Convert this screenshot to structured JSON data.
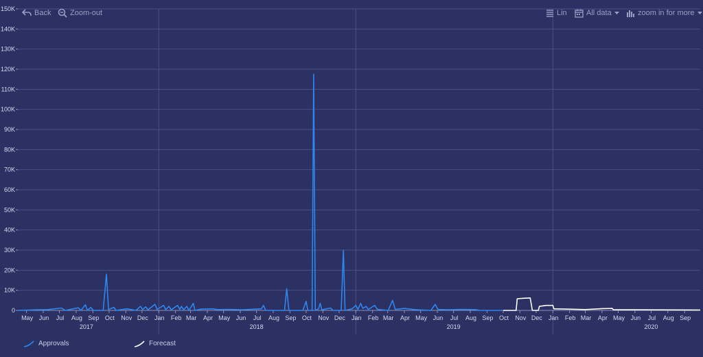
{
  "toolbar": {
    "back_label": "Back",
    "zoom_out_label": "Zoom-out",
    "scale_label": "Lin",
    "range_label": "All data",
    "zoom_in_label": "zoom in for more"
  },
  "legend": {
    "approvals_label": "Approvals",
    "forecast_label": "Forecast"
  },
  "colors": {
    "background": "#2b3163",
    "grid": "#4a5188",
    "approvals": "#2f86ee",
    "forecast": "#ffffff"
  },
  "chart_data": {
    "type": "line",
    "y_ticks": [
      "0",
      "10K",
      "20K",
      "30K",
      "40K",
      "50K",
      "60K",
      "70K",
      "80K",
      "90K",
      "100K",
      "110K",
      "120K",
      "130K",
      "140K",
      "150K"
    ],
    "ylim": [
      0,
      150000
    ],
    "x_range": [
      "2017-04-15",
      "2020-09-30"
    ],
    "month_ticks": [
      {
        "label": "May",
        "date": "2017-05-01"
      },
      {
        "label": "Jun",
        "date": "2017-06-01"
      },
      {
        "label": "Jul",
        "date": "2017-07-01"
      },
      {
        "label": "Aug",
        "date": "2017-08-01"
      },
      {
        "label": "Sep",
        "date": "2017-09-01"
      },
      {
        "label": "Oct",
        "date": "2017-10-01"
      },
      {
        "label": "Nov",
        "date": "2017-11-01"
      },
      {
        "label": "Dec",
        "date": "2017-12-01"
      },
      {
        "label": "Jan",
        "date": "2018-01-01"
      },
      {
        "label": "Feb",
        "date": "2018-02-01"
      },
      {
        "label": "Mar",
        "date": "2018-03-01"
      },
      {
        "label": "Apr",
        "date": "2018-04-01"
      },
      {
        "label": "May",
        "date": "2018-05-01"
      },
      {
        "label": "Jun",
        "date": "2018-06-01"
      },
      {
        "label": "Jul",
        "date": "2018-07-01"
      },
      {
        "label": "Aug",
        "date": "2018-08-01"
      },
      {
        "label": "Sep",
        "date": "2018-09-01"
      },
      {
        "label": "Oct",
        "date": "2018-10-01"
      },
      {
        "label": "Nov",
        "date": "2018-11-01"
      },
      {
        "label": "Dec",
        "date": "2018-12-01"
      },
      {
        "label": "Jan",
        "date": "2019-01-01"
      },
      {
        "label": "Feb",
        "date": "2019-02-01"
      },
      {
        "label": "Mar",
        "date": "2019-03-01"
      },
      {
        "label": "Apr",
        "date": "2019-04-01"
      },
      {
        "label": "May",
        "date": "2019-05-01"
      },
      {
        "label": "Jun",
        "date": "2019-06-01"
      },
      {
        "label": "Jul",
        "date": "2019-07-01"
      },
      {
        "label": "Aug",
        "date": "2019-08-01"
      },
      {
        "label": "Sep",
        "date": "2019-09-01"
      },
      {
        "label": "Oct",
        "date": "2019-10-01"
      },
      {
        "label": "Nov",
        "date": "2019-11-01"
      },
      {
        "label": "Dec",
        "date": "2019-12-01"
      },
      {
        "label": "Jan",
        "date": "2020-01-01"
      },
      {
        "label": "Feb",
        "date": "2020-02-01"
      },
      {
        "label": "Mar",
        "date": "2020-03-01"
      },
      {
        "label": "Apr",
        "date": "2020-04-01"
      },
      {
        "label": "May",
        "date": "2020-05-01"
      },
      {
        "label": "Jun",
        "date": "2020-06-01"
      },
      {
        "label": "Jul",
        "date": "2020-07-01"
      },
      {
        "label": "Aug",
        "date": "2020-08-01"
      },
      {
        "label": "Sep",
        "date": "2020-09-01"
      }
    ],
    "year_labels": [
      {
        "label": "2017",
        "date": "2017-08-20"
      },
      {
        "label": "2018",
        "date": "2018-07-01"
      },
      {
        "label": "2019",
        "date": "2019-07-01"
      },
      {
        "label": "2020",
        "date": "2020-07-01"
      }
    ],
    "year_boundaries": [
      "2018-01-01",
      "2019-01-01",
      "2020-01-01"
    ],
    "legend_position": "bottom-left",
    "grid": true,
    "series": [
      {
        "name": "Approvals",
        "points": [
          [
            "2017-04-15",
            0
          ],
          [
            "2017-05-20",
            300
          ],
          [
            "2017-06-10",
            400
          ],
          [
            "2017-07-05",
            1200
          ],
          [
            "2017-07-12",
            0
          ],
          [
            "2017-08-05",
            1300
          ],
          [
            "2017-08-10",
            0
          ],
          [
            "2017-08-18",
            2800
          ],
          [
            "2017-08-22",
            0
          ],
          [
            "2017-08-28",
            1500
          ],
          [
            "2017-09-02",
            0
          ],
          [
            "2017-09-20",
            0
          ],
          [
            "2017-09-26",
            18000
          ],
          [
            "2017-09-30",
            500
          ],
          [
            "2017-10-10",
            1500
          ],
          [
            "2017-10-14",
            0
          ],
          [
            "2017-11-03",
            800
          ],
          [
            "2017-11-20",
            0
          ],
          [
            "2017-11-28",
            2000
          ],
          [
            "2017-12-02",
            500
          ],
          [
            "2017-12-08",
            1800
          ],
          [
            "2017-12-12",
            300
          ],
          [
            "2017-12-25",
            3000
          ],
          [
            "2017-12-29",
            500
          ],
          [
            "2018-01-10",
            2500
          ],
          [
            "2018-01-14",
            400
          ],
          [
            "2018-01-20",
            2000
          ],
          [
            "2018-01-24",
            300
          ],
          [
            "2018-02-05",
            2500
          ],
          [
            "2018-02-09",
            500
          ],
          [
            "2018-02-12",
            2000
          ],
          [
            "2018-02-16",
            300
          ],
          [
            "2018-02-22",
            2000
          ],
          [
            "2018-02-26",
            0
          ],
          [
            "2018-03-06",
            3500
          ],
          [
            "2018-03-09",
            0
          ],
          [
            "2018-03-20",
            600
          ],
          [
            "2018-04-10",
            800
          ],
          [
            "2018-04-20",
            400
          ],
          [
            "2018-05-10",
            500
          ],
          [
            "2018-06-05",
            300
          ],
          [
            "2018-07-10",
            800
          ],
          [
            "2018-07-14",
            2500
          ],
          [
            "2018-07-18",
            0
          ],
          [
            "2018-08-22",
            0
          ],
          [
            "2018-08-26",
            10800
          ],
          [
            "2018-08-30",
            0
          ],
          [
            "2018-09-25",
            0
          ],
          [
            "2018-10-01",
            4500
          ],
          [
            "2018-10-04",
            0
          ],
          [
            "2018-10-12",
            0
          ],
          [
            "2018-10-15",
            117500
          ],
          [
            "2018-10-18",
            0
          ],
          [
            "2018-10-24",
            800
          ],
          [
            "2018-10-27",
            3500
          ],
          [
            "2018-10-30",
            300
          ],
          [
            "2018-11-15",
            1200
          ],
          [
            "2018-11-20",
            0
          ],
          [
            "2018-12-05",
            0
          ],
          [
            "2018-12-09",
            30000
          ],
          [
            "2018-12-12",
            0
          ],
          [
            "2018-12-25",
            800
          ],
          [
            "2019-01-01",
            2500
          ],
          [
            "2019-01-05",
            500
          ],
          [
            "2019-01-10",
            3500
          ],
          [
            "2019-01-14",
            1000
          ],
          [
            "2019-01-20",
            2000
          ],
          [
            "2019-01-24",
            500
          ],
          [
            "2019-02-05",
            2500
          ],
          [
            "2019-02-10",
            500
          ],
          [
            "2019-03-02",
            0
          ],
          [
            "2019-03-10",
            5000
          ],
          [
            "2019-03-15",
            500
          ],
          [
            "2019-04-01",
            1000
          ],
          [
            "2019-04-20",
            400
          ],
          [
            "2019-05-20",
            0
          ],
          [
            "2019-05-28",
            3000
          ],
          [
            "2019-06-02",
            500
          ],
          [
            "2019-06-20",
            300
          ],
          [
            "2019-07-15",
            500
          ],
          [
            "2019-08-10",
            400
          ],
          [
            "2019-08-20",
            0
          ],
          [
            "2019-09-30",
            0
          ]
        ]
      },
      {
        "name": "Forecast",
        "points": [
          [
            "2019-10-01",
            0
          ],
          [
            "2019-10-25",
            0
          ],
          [
            "2019-10-27",
            5800
          ],
          [
            "2019-11-05",
            6000
          ],
          [
            "2019-11-20",
            6200
          ],
          [
            "2019-11-24",
            0
          ],
          [
            "2019-12-05",
            0
          ],
          [
            "2019-12-07",
            2000
          ],
          [
            "2019-12-20",
            2500
          ],
          [
            "2020-01-01",
            2500
          ],
          [
            "2020-01-03",
            800
          ],
          [
            "2020-02-01",
            600
          ],
          [
            "2020-03-01",
            400
          ],
          [
            "2020-04-01",
            900
          ],
          [
            "2020-04-20",
            1000
          ],
          [
            "2020-04-22",
            300
          ],
          [
            "2020-06-01",
            300
          ],
          [
            "2020-09-30",
            200
          ]
        ]
      }
    ]
  }
}
